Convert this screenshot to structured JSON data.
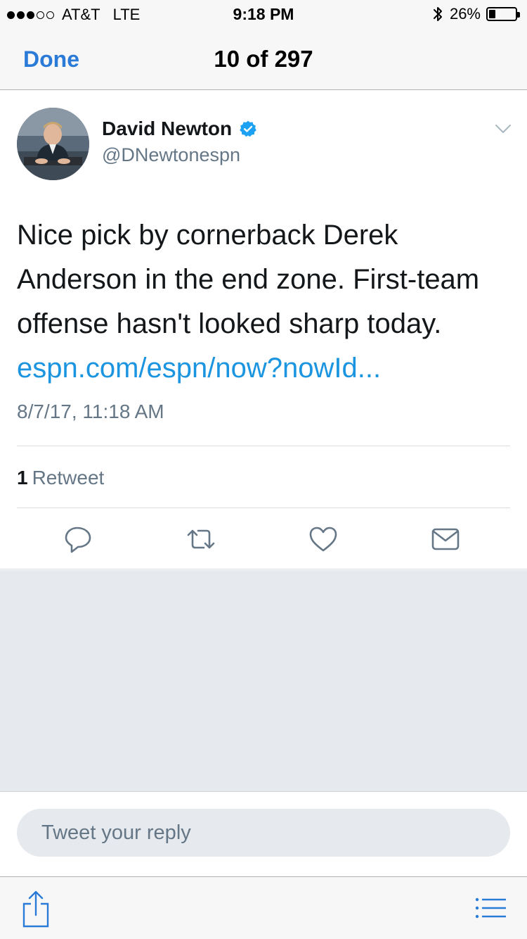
{
  "status_bar": {
    "carrier": "AT&T",
    "network": "LTE",
    "time": "9:18 PM",
    "battery_text": "26%",
    "battery_level": 0.26,
    "signal_bars_filled": 3,
    "signal_bars_total": 5
  },
  "nav": {
    "done_label": "Done",
    "title": "10 of 297"
  },
  "tweet": {
    "author_name": "David Newton",
    "handle": "@DNewtonespn",
    "text": "Nice pick by cornerback Derek Anderson in the end zone. First-team offense hasn't looked sharp today.",
    "link": "espn.com/espn/now?nowId...",
    "timestamp": "8/7/17, 11:18 AM",
    "retweet_count": "1",
    "retweet_label": "Retweet"
  },
  "reply": {
    "placeholder": "Tweet your reply"
  },
  "colors": {
    "accent": "#1da1f2",
    "link": "#1b95e0",
    "nav_blue": "#2a7ad8",
    "secondary_text": "#657786",
    "gray_background": "#e6e9ed"
  },
  "icons": {
    "bluetooth": "bluetooth-icon",
    "verified": "verified-badge-icon",
    "more": "chevron-down-icon",
    "reply": "reply-icon",
    "retweet": "retweet-icon",
    "like": "heart-icon",
    "dm": "envelope-icon",
    "share": "share-icon",
    "list": "list-icon"
  }
}
